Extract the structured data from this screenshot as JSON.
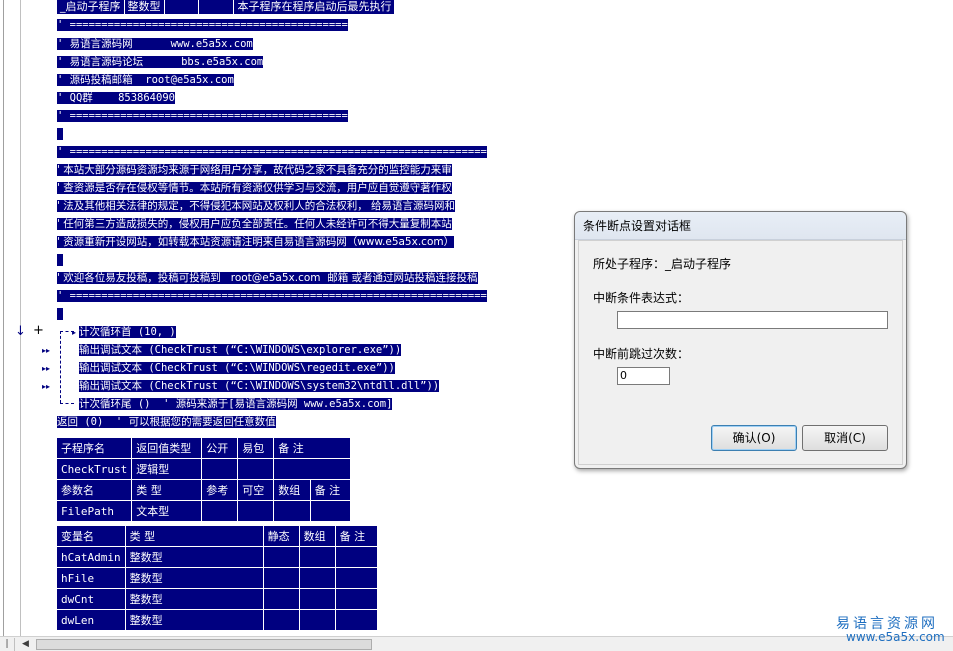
{
  "top_row": [
    "_启动子程序",
    "整数型",
    "        ",
    "        ",
    "本子程序在程序启动后最先执行"
  ],
  "comment_lines": [
    "' ============================================",
    "' 易语言源码网      www.e5a5x.com",
    "' 易语言源码论坛      bbs.e5a5x.com",
    "' 源码投稿邮箱  root@e5a5x.com",
    "' QQ群    853864090",
    "' ============================================",
    " ",
    "' ==================================================================",
    "' 本站大部分源码资源均来源于网络用户分享，故代码之家不具备充分的监控能力来审",
    "' 查资源是否存在侵权等情节。本站所有资源仅供学习与交流，用户应自觉遵守著作权",
    "' 法及其他相关法律的规定，不得侵犯本网站及权利人的合法权利， 给易语言源码网和",
    "' 任何第三方造成损失的，侵权用户应负全部责任。任何人未经许可不得大量复制本站",
    "' 资源重新开设网站，如转载本站资源请注明来自易语言源码网（www.e5a5x.com）",
    " ",
    "' 欢迎各位易友投稿，投稿可投稿到   root@e5a5x.com  邮箱 或者通过网站投稿连接投稿",
    "' ==================================================================",
    " "
  ],
  "code_lines": [
    "计次循环首 (10, )",
    "输出调试文本 (CheckTrust (“C:\\WINDOWS\\explorer.exe”))",
    "输出调试文本 (CheckTrust (“C:\\WINDOWS\\regedit.exe”))",
    "输出调试文本 (CheckTrust (“C:\\WINDOWS\\system32\\ntdll.dll”))",
    "计次循环尾 ()  ' 源码来源于[易语言源码网 www.e5a5x.com]"
  ],
  "return_line": "返回 (0)  ' 可以根据您的需要返回任意数值",
  "gutter": {
    "arrow": "↓",
    "plus": "+",
    "break_marker": "▸▸"
  },
  "sub_table": {
    "header": [
      "子程序名",
      "返回值类型",
      "公开",
      "易包",
      "备 注"
    ],
    "row": [
      "CheckTrust",
      "逻辑型",
      "",
      "",
      ""
    ],
    "param_header": [
      "参数名",
      "类 型",
      "参考",
      "可空",
      "数组",
      "备 注"
    ],
    "param_row": [
      "FilePath",
      "文本型",
      "",
      "",
      "",
      ""
    ]
  },
  "var_table": {
    "header": [
      "变量名",
      "类 型",
      "静态",
      "数组",
      "备 注"
    ],
    "rows": [
      [
        "hCatAdmin",
        "整数型",
        "",
        "",
        ""
      ],
      [
        "hFile",
        "整数型",
        "",
        "",
        ""
      ],
      [
        "dwCnt",
        "整数型",
        "",
        "",
        ""
      ],
      [
        "dwLen",
        "整数型",
        "",
        "",
        ""
      ]
    ]
  },
  "dialog": {
    "title": "条件断点设置对话框",
    "sub_label": "所处子程序：_启动子程序",
    "condition_label": "中断条件表达式：",
    "condition_value": "",
    "skip_label": "中断前跳过次数：",
    "skip_value": "0",
    "ok_label": "确认(O)",
    "cancel_label": "取消(C)"
  },
  "watermark": {
    "cn": "易语言资源网",
    "url": "www.e5a5x.com"
  },
  "colors": {
    "highlight": "#000080",
    "text_on_highlight": "#ffffff",
    "watermark": "#1f6fc0"
  }
}
